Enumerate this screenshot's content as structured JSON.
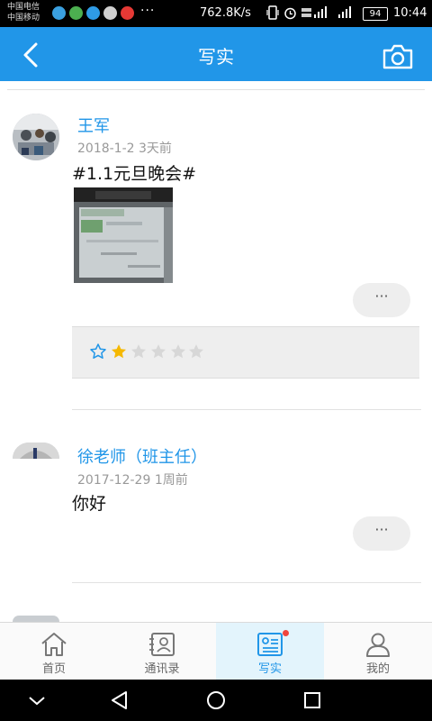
{
  "status_bar": {
    "carrier_1": "中国电信",
    "carrier_2": "中国移动",
    "more": "···",
    "speed": "762.8K/s",
    "battery": "94",
    "time": "10:44"
  },
  "header": {
    "title": "写实",
    "back_icon": "chevron-left-icon",
    "camera_icon": "camera-icon"
  },
  "posts": [
    {
      "author": "王军",
      "date": "2018-1-2",
      "relative_time": "3天前",
      "content": "#1.1元旦晚会#",
      "has_photo": true,
      "more_label": "···",
      "rating": {
        "outline_icon": "star-outline-icon",
        "filled": 1,
        "total": 5
      }
    },
    {
      "author": "徐老师（班主任）",
      "date": "2017-12-29",
      "relative_time": "1周前",
      "content": "你好",
      "has_photo": false,
      "more_label": "···"
    }
  ],
  "bottom_nav": {
    "tabs": [
      {
        "label": "首页",
        "icon": "home-icon",
        "active": false
      },
      {
        "label": "通讯录",
        "icon": "contacts-icon",
        "active": false
      },
      {
        "label": "写实",
        "icon": "record-icon",
        "active": true,
        "badge": true
      },
      {
        "label": "我的",
        "icon": "user-icon",
        "active": false
      }
    ]
  },
  "colors": {
    "accent": "#2196e8",
    "star_filled": "#f5b800",
    "star_empty": "#d7d7d7",
    "badge": "#f0443d"
  }
}
